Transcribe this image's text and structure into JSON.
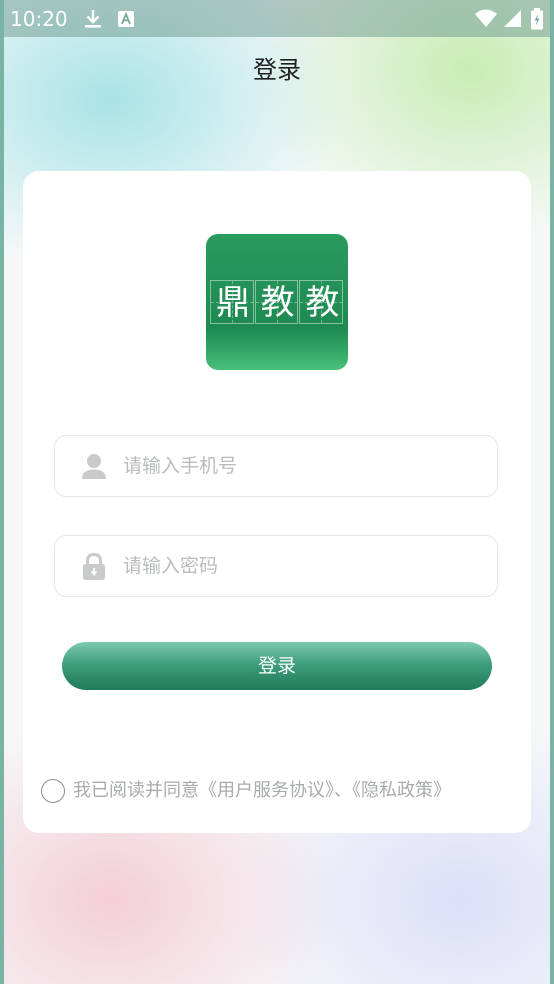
{
  "status_bar": {
    "time": "10:20",
    "icons": {
      "left": [
        "download-icon",
        "font-a-icon"
      ],
      "right": [
        "wifi-icon",
        "signal-icon",
        "battery-icon"
      ]
    }
  },
  "header": {
    "title": "登录"
  },
  "logo": {
    "chars": [
      "鼎",
      "教",
      "教"
    ],
    "color": "#1e8a52"
  },
  "form": {
    "phone": {
      "icon": "user-icon",
      "placeholder": "请输入手机号",
      "value": ""
    },
    "password": {
      "icon": "lock-icon",
      "placeholder": "请输入密码",
      "value": ""
    },
    "login_label": "登录"
  },
  "agreement": {
    "checked": false,
    "prefix": "我已阅读并同意",
    "user_agreement": "《用户服务协议》",
    "separator": "、",
    "privacy_policy": "《隐私政策》"
  },
  "colors": {
    "accent": "#2a8c66",
    "placeholder": "#b9bcbf",
    "muted_text": "#a8abae"
  }
}
